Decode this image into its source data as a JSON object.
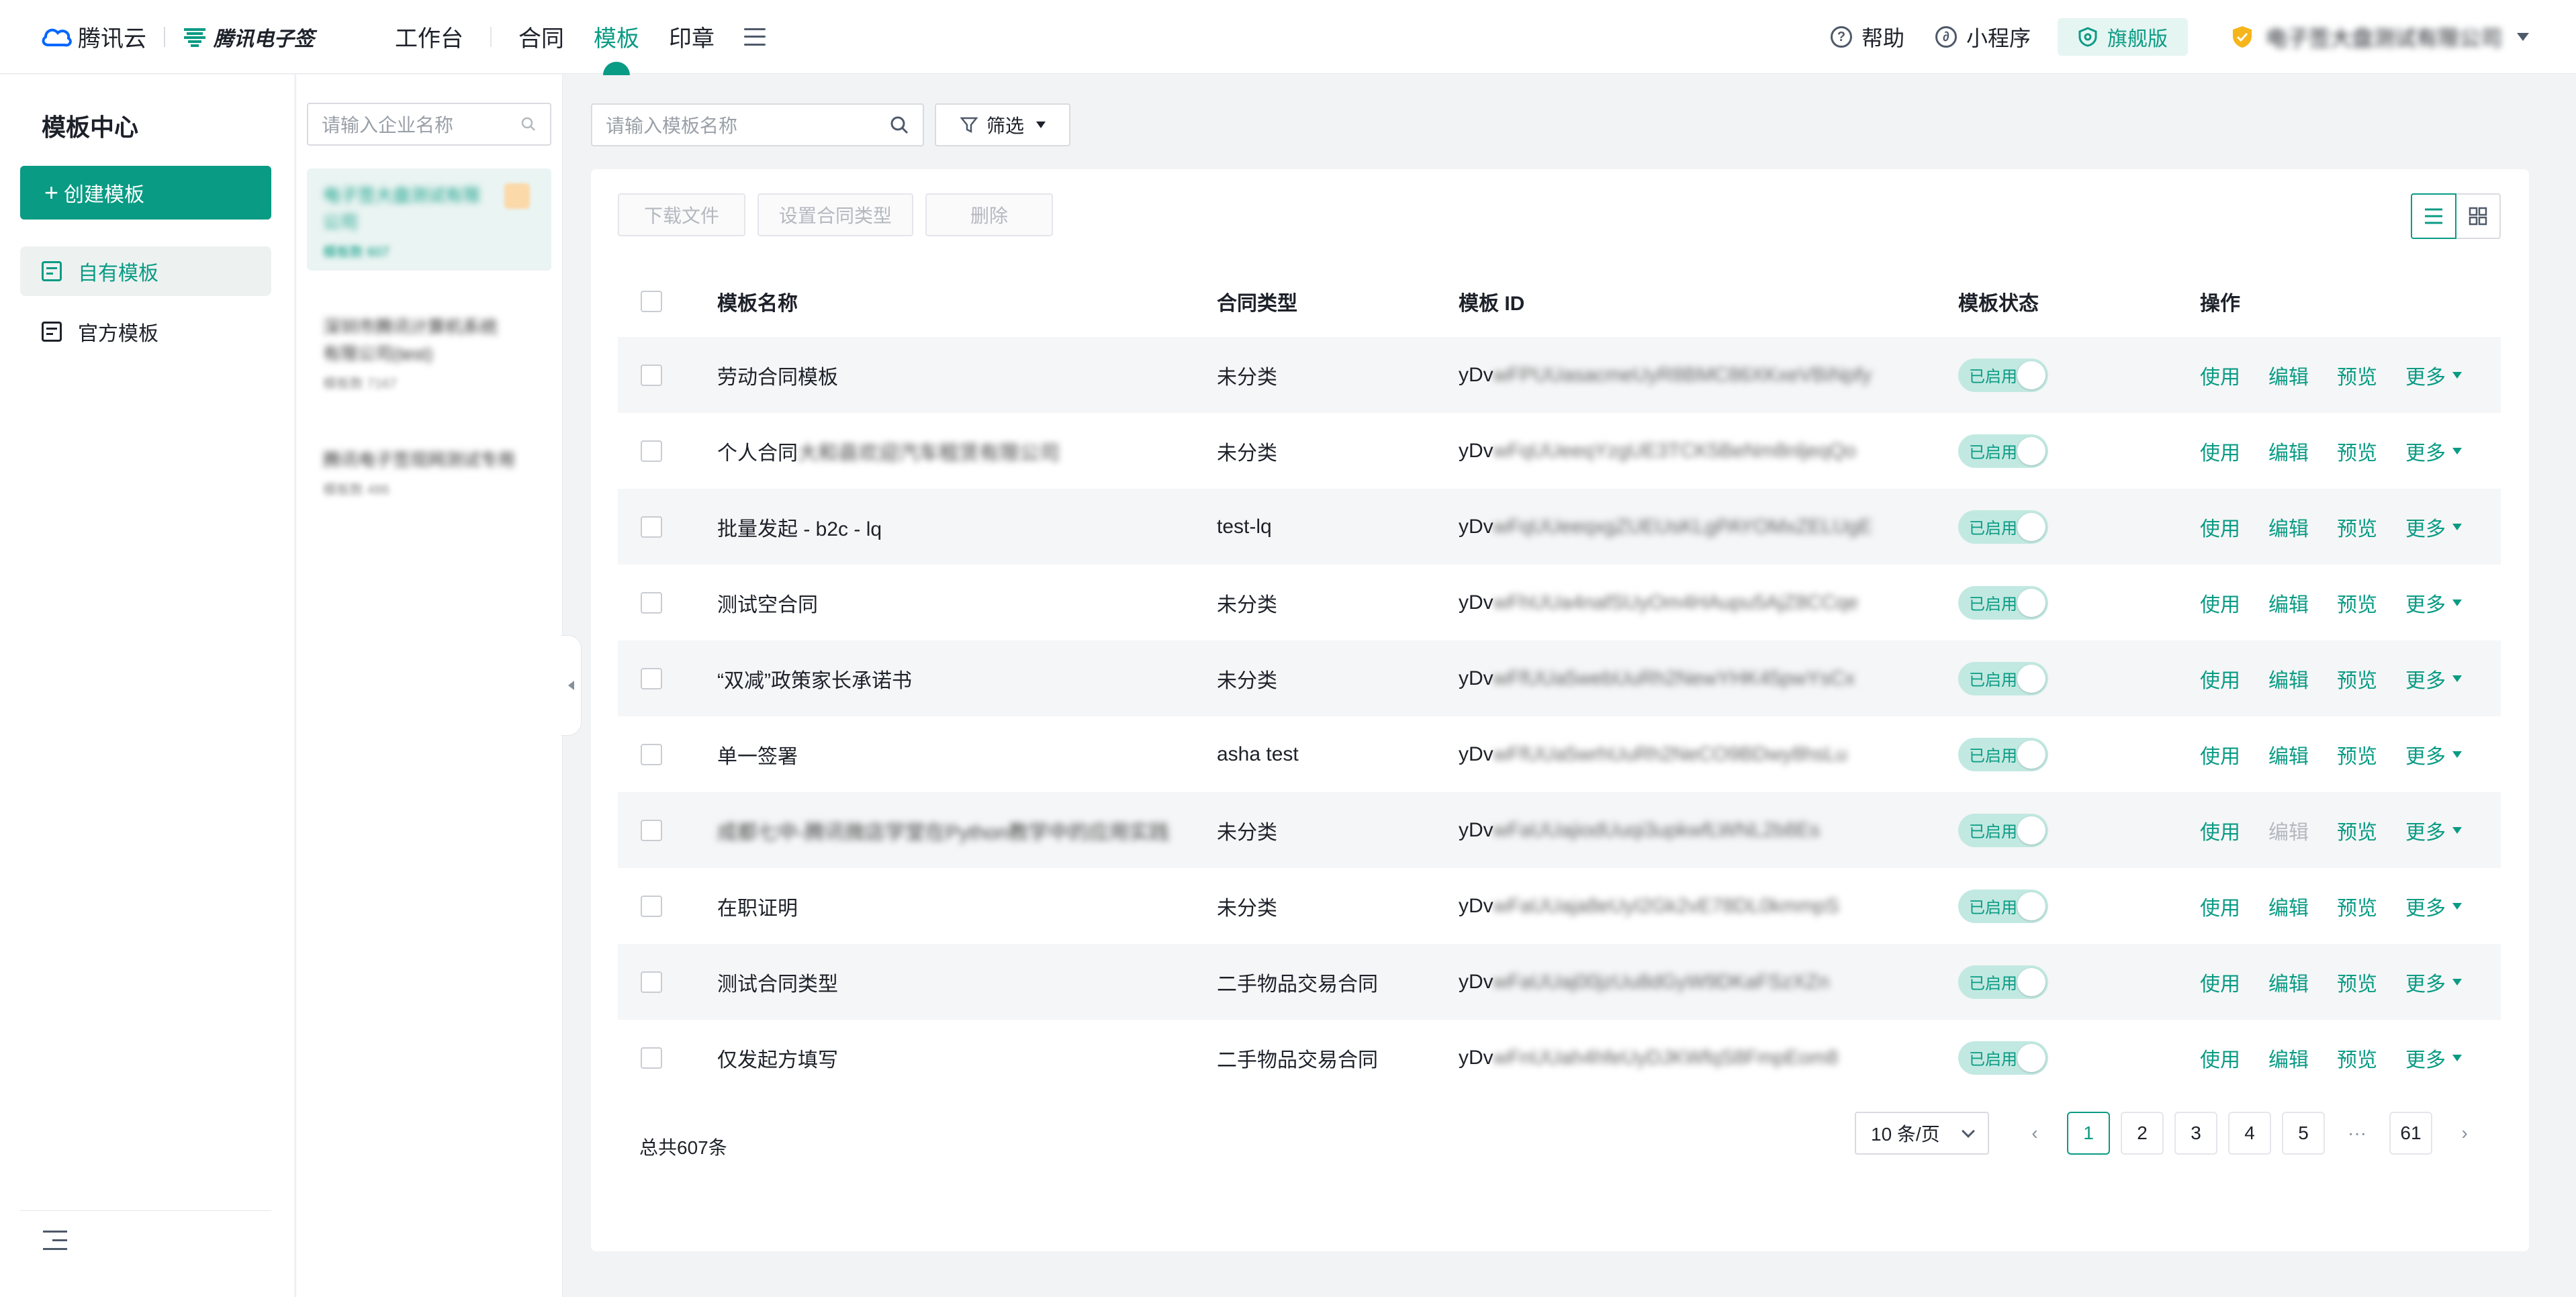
{
  "header": {
    "brand": "腾讯云",
    "product": "腾讯电子签",
    "nav": [
      {
        "label": "工作台"
      },
      {
        "label": "合同"
      },
      {
        "label": "模板"
      },
      {
        "label": "印章"
      }
    ],
    "help": "帮助",
    "mini_program": "小程序",
    "edition": "旗舰版",
    "company": "电子签大盘测试有限公司"
  },
  "sidebar": {
    "title": "模板中心",
    "create_label": "创建模板",
    "items": [
      {
        "label": "自有模板"
      },
      {
        "label": "官方模板"
      }
    ]
  },
  "companies": {
    "search_placeholder": "请输入企业名称",
    "items": [
      {
        "name": "电子签大盘测试有限公司",
        "sub": "模板数 607"
      },
      {
        "name": "深圳市腾讯计算机系统有限公司(test)",
        "sub": "模板数 7167"
      },
      {
        "name": "腾讯电子签现网测试专用",
        "sub": "模板数 486"
      }
    ]
  },
  "main": {
    "search_placeholder": "请输入模板名称",
    "filter_label": "筛选",
    "toolbar": {
      "download": "下载文件",
      "set_type": "设置合同类型",
      "delete": "删除"
    },
    "columns": {
      "name": "模板名称",
      "type": "合同类型",
      "id": "模板 ID",
      "status": "模板状态",
      "ops": "操作"
    },
    "ops": {
      "use": "使用",
      "edit": "编辑",
      "preview": "预览",
      "more": "更多"
    },
    "status_label": "已启用",
    "rows": [
      {
        "name": "劳动合同模板",
        "name_blur": "",
        "type": "未分类",
        "id_prefix": "yDv",
        "id_rest": "wFPUUasacmeUyR8BMC86XKxeVBiNpfy"
      },
      {
        "name": "个人合同",
        "name_blur": "大和县欢迎汽车租赁有限公司",
        "type": "未分类",
        "id_prefix": "yDv",
        "id_rest": "wFqUUeeqYzgUE3TCK5BeNm8nljeqQo"
      },
      {
        "name": "批量发起 - b2c - lq",
        "name_blur": "",
        "type": "test-lq",
        "id_prefix": "yDv",
        "id_rest": "wFqUUeeqxgZUEUsKLgPAYOMxZELUgE"
      },
      {
        "name": "测试空合同",
        "name_blur": "",
        "type": "未分类",
        "id_prefix": "yDv",
        "id_rest": "wFhUUa4nafSUyOm4HAupu5AjZ8CCqe"
      },
      {
        "name": "“双减”政策家长承诺书",
        "name_blur": "",
        "type": "未分类",
        "id_prefix": "yDv",
        "id_rest": "wFfUUa5webUuRh2NewYHK45pwYsCx"
      },
      {
        "name": "单一签署",
        "name_blur": "",
        "type": "asha test",
        "id_prefix": "yDv",
        "id_rest": "wFfUUa5wrhUuRh2NeCO9BDwy8hsLu"
      },
      {
        "name": "",
        "name_blur": "成都七中-腾讯微店学堂在Python教学中的应用实践",
        "type": "未分类",
        "id_prefix": "yDv",
        "id_rest": "wFaUUajiodUuqi3upkwfLWNL2b8Es"
      },
      {
        "name": "在职证明",
        "name_blur": "",
        "type": "未分类",
        "id_prefix": "yDv",
        "id_rest": "wFaUUaja8eUyI2Gk2vE78DL0kmmpS"
      },
      {
        "name": "测试合同类型",
        "name_blur": "",
        "type": "二手物品交易合同",
        "id_prefix": "yDv",
        "id_rest": "wFaUUaj00jzUu8dGyW9DKaFSzXZn"
      },
      {
        "name": "仅发起方填写",
        "name_blur": "",
        "type": "二手物品交易合同",
        "id_prefix": "yDv",
        "id_rest": "wFnUUah4hfeUyDJKWfqS8FmpEom8"
      }
    ],
    "total": "总共607条",
    "page_size": "10 条/页",
    "pages": [
      "1",
      "2",
      "3",
      "4",
      "5",
      "···",
      "61"
    ]
  }
}
